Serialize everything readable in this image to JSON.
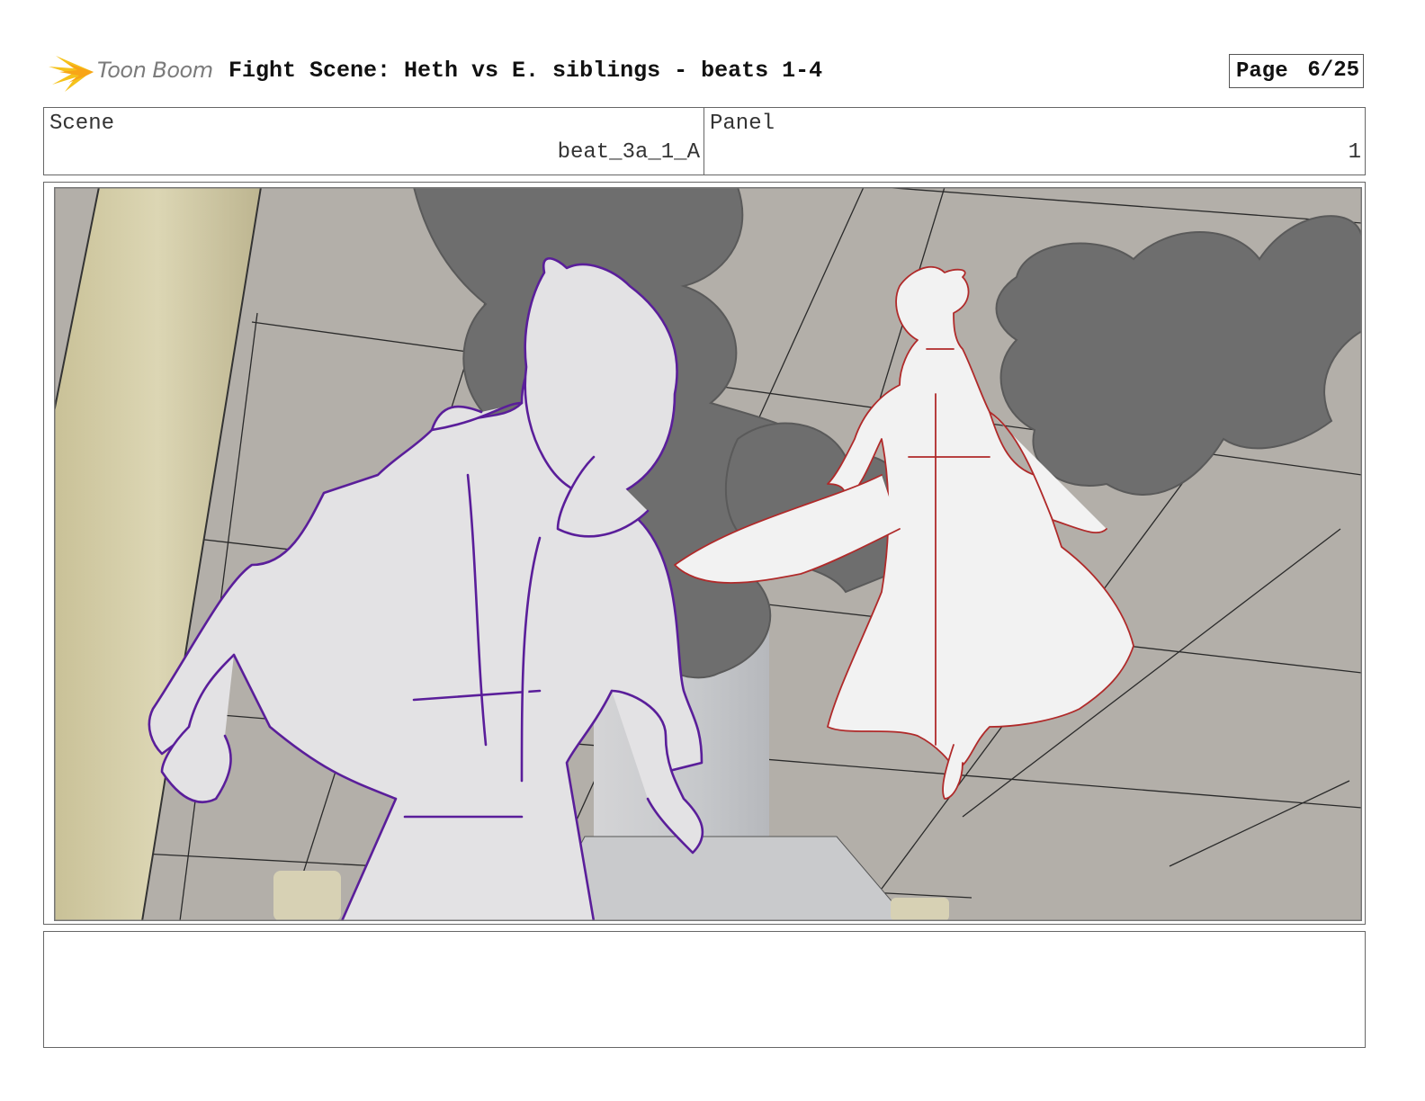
{
  "header": {
    "logo_text": "Toon Boom",
    "title": "Fight Scene: Heth vs E. siblings - beats 1-4",
    "page_label": "Page",
    "page_number": "6/25"
  },
  "info": {
    "scene_label": "Scene",
    "scene_value": "beat_3a_1_A",
    "panel_label": "Panel",
    "panel_value": "1"
  },
  "notes": {
    "text": ""
  },
  "colors": {
    "sketch_left": "#5a1e9a",
    "sketch_right": "#b02a2a",
    "background_fill": "#b3afa9",
    "smoke_fill": "#6e6e6e",
    "logo_accent": "#f5c21b"
  }
}
